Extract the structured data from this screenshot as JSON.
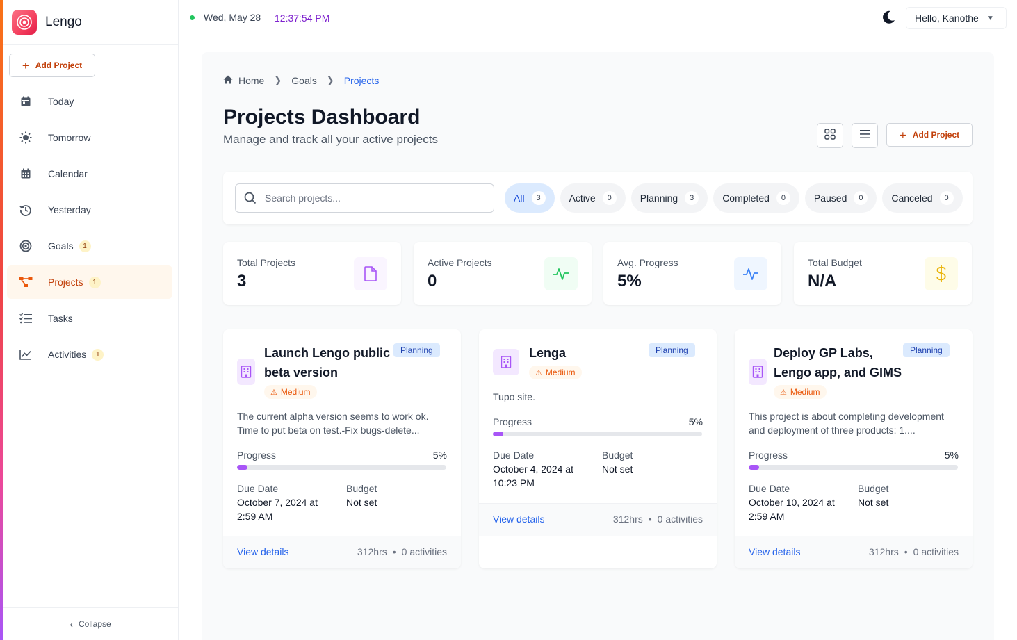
{
  "app": {
    "name": "Lengo",
    "add_project": "Add Project",
    "collapse": "Collapse"
  },
  "sidebar": {
    "items": [
      {
        "label": "Today",
        "icon": "calendar-day-icon",
        "badge": ""
      },
      {
        "label": "Tomorrow",
        "icon": "sun-icon",
        "badge": ""
      },
      {
        "label": "Calendar",
        "icon": "calendar-icon",
        "badge": ""
      },
      {
        "label": "Yesterday",
        "icon": "history-icon",
        "badge": ""
      },
      {
        "label": "Goals",
        "icon": "target-icon",
        "badge": "1"
      },
      {
        "label": "Projects",
        "icon": "project-diagram-icon",
        "badge": "1",
        "active": true
      },
      {
        "label": "Tasks",
        "icon": "tasks-icon",
        "badge": ""
      },
      {
        "label": "Activities",
        "icon": "chart-line-icon",
        "badge": "1"
      }
    ]
  },
  "topbar": {
    "date": "Wed, May 28",
    "time": "12:37:54 PM",
    "greeting": "Hello, Kanothe"
  },
  "breadcrumb": [
    "Home",
    "Goals",
    "Projects"
  ],
  "page": {
    "title": "Projects Dashboard",
    "subtitle": "Manage and track all your active projects",
    "add_project": "Add Project"
  },
  "search": {
    "placeholder": "Search projects..."
  },
  "filters": [
    {
      "label": "All",
      "count": "3",
      "active": true
    },
    {
      "label": "Active",
      "count": "0"
    },
    {
      "label": "Planning",
      "count": "3"
    },
    {
      "label": "Completed",
      "count": "0"
    },
    {
      "label": "Paused",
      "count": "0"
    },
    {
      "label": "Canceled",
      "count": "0"
    }
  ],
  "stats": [
    {
      "label": "Total Projects",
      "value": "3",
      "icon": "file-icon",
      "color": "#a855f7"
    },
    {
      "label": "Active Projects",
      "value": "0",
      "icon": "pulse-icon",
      "color": "#22c55e"
    },
    {
      "label": "Avg. Progress",
      "value": "5%",
      "icon": "activity-icon",
      "color": "#3b82f6"
    },
    {
      "label": "Total Budget",
      "value": "N/A",
      "icon": "dollar-icon",
      "color": "#eab308"
    }
  ],
  "projects": [
    {
      "title_lines": [
        "Launch Lengo public",
        "beta version"
      ],
      "status": "Planning",
      "priority": "Medium",
      "description_lines": [
        "The current alpha version seems to work ok.",
        "Time to put beta on test.-Fix bugs-delete..."
      ],
      "progress_label": "Progress",
      "progress": "5%",
      "progress_value": 0.05,
      "due_label": "Due Date",
      "due_lines": [
        "October 7, 2024 at",
        "2:59 AM"
      ],
      "budget_label": "Budget",
      "budget": "Not set",
      "link": "View details",
      "hours": "312hrs",
      "activities": "0 activities"
    },
    {
      "title_lines": [
        "Lenga"
      ],
      "status": "Planning",
      "priority": "Medium",
      "description_lines": [
        "Tupo site."
      ],
      "progress_label": "Progress",
      "progress": "5%",
      "progress_value": 0.05,
      "due_label": "Due Date",
      "due_lines": [
        "October 4, 2024 at",
        "10:23 PM"
      ],
      "budget_label": "Budget",
      "budget": "Not set",
      "link": "View details",
      "hours": "312hrs",
      "activities": "0 activities"
    },
    {
      "title_lines": [
        "Deploy GP Labs,",
        "Lengo app, and GIMS"
      ],
      "status": "Planning",
      "priority": "Medium",
      "description_lines": [
        "This project is about completing development",
        "and deployment of three products: 1...."
      ],
      "progress_label": "Progress",
      "progress": "5%",
      "progress_value": 0.05,
      "due_label": "Due Date",
      "due_lines": [
        "October 10, 2024 at",
        "2:59 AM"
      ],
      "budget_label": "Budget",
      "budget": "Not set",
      "link": "View details",
      "hours": "312hrs",
      "activities": "0 activities"
    }
  ]
}
